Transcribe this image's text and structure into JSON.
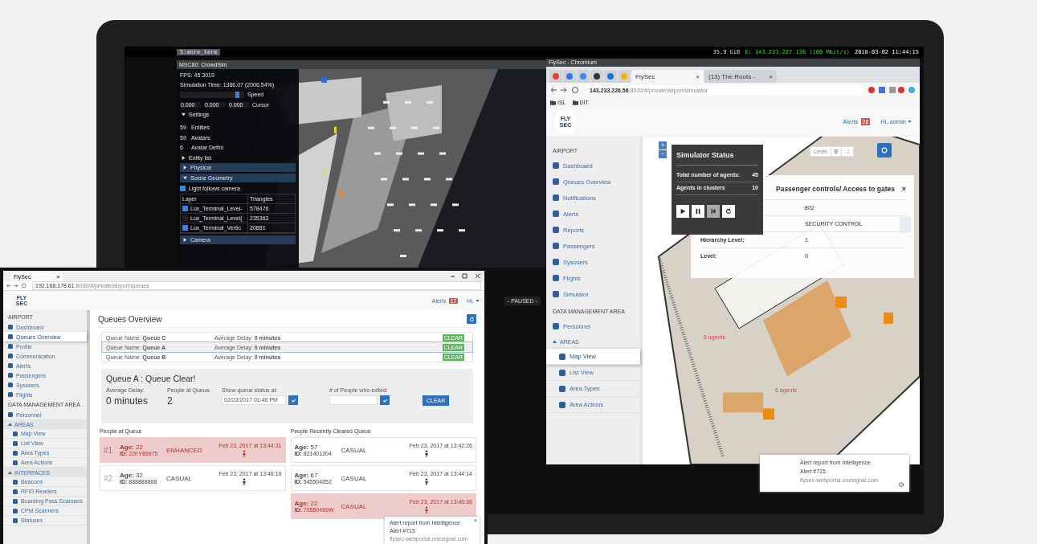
{
  "desktop": {
    "workspace_tab": "5:more_term",
    "status": [
      {
        "kind": "plain",
        "text": "35.9 GiB"
      },
      {
        "kind": "net",
        "text": "E: 143.233.227.136 (100 Mbit/s)"
      },
      {
        "kind": "clock",
        "text": "2018-03-02 11:44:15"
      }
    ]
  },
  "sim_window": {
    "title": "MSC80: CrowdSim",
    "fps": "FPS: 45.3019",
    "sim_time": "Simulation Time: 1386.07 (2006.54%)",
    "speed": {
      "label": "Speed",
      "level": 0.94
    },
    "cursor": {
      "values": [
        "0.000",
        "0.000",
        "0.000"
      ],
      "label": "Cursor"
    },
    "items": [
      {
        "kind": "tree",
        "label": "Settings",
        "expanded": true
      },
      {
        "kind": "stat",
        "value": "59",
        "label": "Entities"
      },
      {
        "kind": "stat",
        "value": "59",
        "label": "Avatars"
      },
      {
        "kind": "stat",
        "value": "6",
        "label": "Avatar Defini"
      },
      {
        "kind": "tree",
        "label": "Entity list",
        "expanded": false
      },
      {
        "kind": "header",
        "label": "Physical",
        "expanded": false
      },
      {
        "kind": "header",
        "label": "Scene Geometry",
        "expanded": true
      },
      {
        "kind": "check",
        "label": "Light follows camera",
        "checked": true
      },
      {
        "kind": "table",
        "columns": [
          "Layer",
          "Triangles"
        ],
        "rows": [
          {
            "checked": true,
            "layer": "Lux_Terminal_Level-",
            "triangles": "578476"
          },
          {
            "checked": false,
            "layer": "Lux_Terminal_Level(",
            "triangles": "235363"
          },
          {
            "checked": true,
            "layer": "Lux_Terminal_Vertic",
            "triangles": "20881"
          }
        ]
      },
      {
        "kind": "header",
        "label": "Camera",
        "expanded": false
      }
    ],
    "paused": "- PAUSED -"
  },
  "browser": {
    "title": "FlySec - Chromium",
    "tabs": [
      {
        "kind": "icon",
        "color": "#e24329",
        "selected": false
      },
      {
        "kind": "icon",
        "color": "#2979ff",
        "selected": false
      },
      {
        "kind": "icon",
        "color": "#4285f4",
        "selected": false
      },
      {
        "kind": "icon",
        "color": "#333333",
        "selected": false
      },
      {
        "kind": "icon",
        "color": "#1976d2",
        "selected": false
      },
      {
        "kind": "icon",
        "color": "#f4b400",
        "selected": false
      },
      {
        "kind": "page",
        "label": "FlySec",
        "close": "×",
        "selected": true
      },
      {
        "kind": "page",
        "label": "(13) The Roots -",
        "close": "×",
        "selected": false
      }
    ],
    "url_host": "143.233.226.56",
    "url_path": ":8000/#/private/airport/simulator",
    "bookmarks": [
      "ISL",
      "DIT"
    ]
  },
  "app": {
    "logo": [
      "FLY",
      "SEC"
    ],
    "alerts_label": "Alerts",
    "alerts_count": "26",
    "user": "Hi, admin",
    "sidebar": [
      {
        "kind": "heading",
        "label": "AIRPORT"
      },
      {
        "kind": "item",
        "label": "Dashboard",
        "selected": false
      },
      {
        "kind": "item",
        "label": "Queues Overview",
        "selected": false
      },
      {
        "kind": "item",
        "label": "Notifications",
        "selected": false
      },
      {
        "kind": "item",
        "label": "Alerts",
        "selected": false
      },
      {
        "kind": "item",
        "label": "Reports",
        "selected": false
      },
      {
        "kind": "item",
        "label": "Passengers",
        "selected": false
      },
      {
        "kind": "item",
        "label": "Sysusers",
        "selected": false
      },
      {
        "kind": "item",
        "label": "Flights",
        "selected": false
      },
      {
        "kind": "item",
        "label": "Simulator",
        "selected": false
      },
      {
        "kind": "heading",
        "label": "DATA MANAGEMENT AREA"
      },
      {
        "kind": "item",
        "label": "Personnel",
        "selected": false
      },
      {
        "kind": "group",
        "label": "AREAS",
        "expanded": true
      },
      {
        "kind": "sub",
        "label": "Map View",
        "selected": true
      },
      {
        "kind": "sub",
        "label": "List View",
        "selected": false
      },
      {
        "kind": "sub",
        "label": "Area Types",
        "selected": false
      },
      {
        "kind": "sub",
        "label": "Area Actions",
        "selected": false
      }
    ],
    "map": {
      "level_label": "Level",
      "levels": [
        {
          "label": "0",
          "selected": true
        },
        {
          "label": "-1",
          "selected": false
        }
      ],
      "zoom": [
        "+",
        "−"
      ],
      "labels": [
        "6 agents",
        "6 agents"
      ]
    },
    "sim_status": {
      "title": "Simulator Status",
      "rows": [
        {
          "label": "Total number of agents:",
          "value": "45"
        },
        {
          "label": "Agents in clusters",
          "value": "10"
        }
      ],
      "controls": [
        {
          "kind": "play",
          "selected": false
        },
        {
          "kind": "pause",
          "selected": false
        },
        {
          "kind": "step",
          "selected": true
        },
        {
          "kind": "reset",
          "selected": false
        }
      ]
    },
    "area_dialog": {
      "title": "Passenger controls/ Access to gates",
      "close": "×",
      "rows": [
        {
          "value": "802"
        },
        {
          "value": "SECURITY CONTROL"
        },
        {
          "label": "Hierarchy Level:",
          "value": "1"
        },
        {
          "label": "Level:",
          "value": "0"
        }
      ]
    },
    "notification": {
      "title": "Alert report from Intelligence",
      "body": "Alert #715",
      "source": "flysec-webportal.onesignal.com"
    }
  },
  "inset": {
    "tab": "FlySec",
    "tab_close": "×",
    "url_host": "192.168.178.61",
    "url_path": ":8000/#/private/airport/queues",
    "logo": [
      "FLY",
      "SEC"
    ],
    "alerts_label": "Alerts",
    "alerts_count": "17",
    "user": "Hi,",
    "sidebar": [
      {
        "kind": "heading",
        "label": "AIRPORT"
      },
      {
        "kind": "item",
        "label": "Dashboard",
        "selected": false
      },
      {
        "kind": "item",
        "label": "Queues Overview",
        "selected": true
      },
      {
        "kind": "item",
        "label": "Profile",
        "selected": false
      },
      {
        "kind": "item",
        "label": "Communication",
        "selected": false
      },
      {
        "kind": "item",
        "label": "Alerts",
        "selected": false
      },
      {
        "kind": "item",
        "label": "Passengers",
        "selected": false
      },
      {
        "kind": "item",
        "label": "Sysusers",
        "selected": false
      },
      {
        "kind": "item",
        "label": "Flights",
        "selected": false
      },
      {
        "kind": "heading",
        "label": "DATA MANAGEMENT AREA"
      },
      {
        "kind": "item",
        "label": "Personnel",
        "selected": false
      },
      {
        "kind": "group",
        "label": "AREAS",
        "expanded": true
      },
      {
        "kind": "sub",
        "label": "Map View",
        "selected": false
      },
      {
        "kind": "sub",
        "label": "List View",
        "selected": false
      },
      {
        "kind": "sub",
        "label": "Area Types",
        "selected": false
      },
      {
        "kind": "sub",
        "label": "Area Actions",
        "selected": false
      },
      {
        "kind": "group",
        "label": "INTERFACES",
        "expanded": true
      },
      {
        "kind": "sub",
        "label": "Beacons",
        "selected": false
      },
      {
        "kind": "sub",
        "label": "RFID Readers",
        "selected": false
      },
      {
        "kind": "sub",
        "label": "Boarding Pass Scanners",
        "selected": false
      },
      {
        "kind": "sub",
        "label": "CPM Scanners",
        "selected": false
      },
      {
        "kind": "sub",
        "label": "Statuses",
        "selected": false
      }
    ],
    "title": "Queues Overview",
    "queues": [
      {
        "name": "Queue Name: **Queue C**",
        "delay": "Average Delay: **0 minutes**",
        "status": "CLEAR",
        "selected": false
      },
      {
        "name": "Queue Name: **Queue A**",
        "delay": "Average Delay: **0 minutes**",
        "status": "CLEAR",
        "selected": true
      },
      {
        "name": "Queue Name: **Queue B**",
        "delay": "Average Delay: **0 minutes**",
        "status": "CLEAR",
        "selected": false
      }
    ],
    "detail": {
      "title": "Queue A : Queue Clear!",
      "avg_label": "Average Delay:",
      "avg_value": "0 minutes",
      "people_label": "People at Queue:",
      "people_value": "2",
      "status_label": "Show queue status at:",
      "status_value": "02/23/2017 01:46 PM",
      "exited_label": "# of People who exited:",
      "clear": "CLEAR"
    },
    "at_queue": {
      "title": "People at Queue",
      "cards": [
        {
          "rank": "#1",
          "age": "**Age:** 22",
          "id": "**ID:** 22FY85975",
          "class": "ENHANCED",
          "time": "Feb 23, 2017 at 13:44:31",
          "flagged": true
        },
        {
          "rank": "#2",
          "age": "**Age:** 32",
          "id": "**ID:** 888888888",
          "class": "CASUAL",
          "time": "Feb 23, 2017 at 13:46:19",
          "flagged": false
        }
      ]
    },
    "cleared": {
      "title": "People Recently Cleared Queue",
      "cards": [
        {
          "age": "**Age:** 57",
          "id": "**ID:** 821401204",
          "class": "CASUAL",
          "time": "Feb 23, 2017 at 13:42:26",
          "flagged": false
        },
        {
          "age": "**Age:** 67",
          "id": "**ID:** 545504652",
          "class": "CASUAL",
          "time": "Feb 23, 2017 at 13:44:14",
          "flagged": false
        },
        {
          "age": "**Age:** 22",
          "id": "**ID:** 79550469W",
          "class": "CASUAL",
          "time": "Feb 23, 2017 at 13:45:36",
          "flagged": true
        }
      ]
    },
    "notification": {
      "title": "Alert report from Intelligence",
      "body": "Alert #715",
      "source": "flysec-webportal.onesignal.com",
      "close": "×"
    }
  }
}
